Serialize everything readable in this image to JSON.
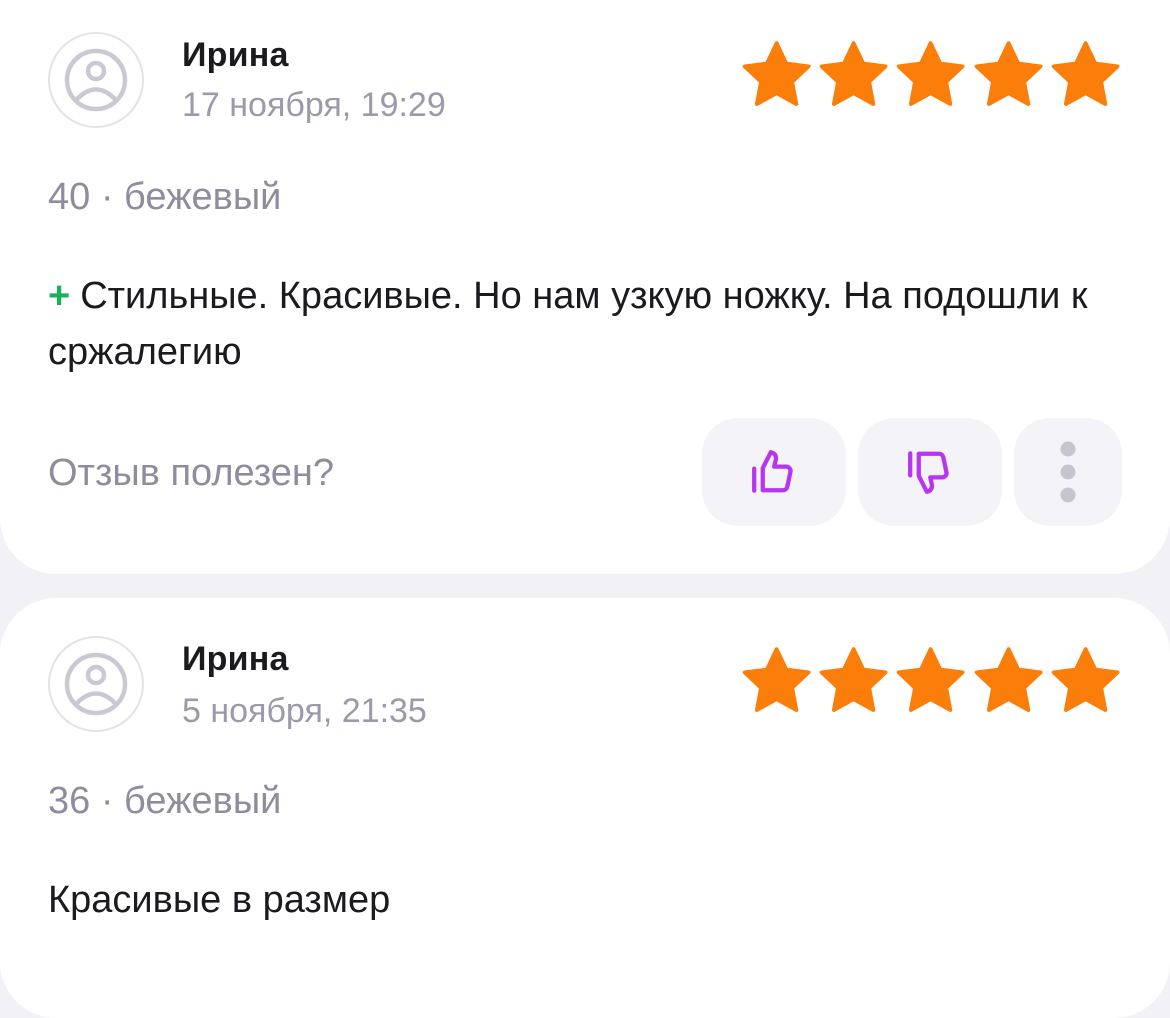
{
  "colors": {
    "star": "#fb7d0a",
    "plus": "#17b257",
    "vote_icon": "#b735f0",
    "muted_text": "#8e8d9d",
    "button_bg": "#f4f3f8"
  },
  "reviews": [
    {
      "author": "Ирина",
      "date": "17 ноября, 19:29",
      "rating": 5,
      "variant": "40 · бежевый",
      "plus_sign": "+",
      "text": "Стильные. Красивые. Но нам узкую ножку. На подошли к сржалегию",
      "helpful_label": "Отзыв полезен?",
      "icons": {
        "avatar": "sad-face-icon",
        "like": "thumbs-up-icon",
        "dislike": "thumbs-down-icon",
        "more": "more-vertical-icon"
      }
    },
    {
      "author": "Ирина",
      "date": "5 ноября, 21:35",
      "rating": 5,
      "variant": "36 · бежевый",
      "text": "Красивые в размер"
    }
  ]
}
